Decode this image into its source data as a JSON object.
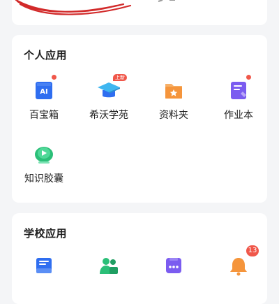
{
  "personal_apps": {
    "title": "个人应用",
    "items": [
      {
        "label": "百宝箱",
        "icon": "ai-icon",
        "icon_text": "AI",
        "dot": true
      },
      {
        "label": "希沃学苑",
        "icon": "graduation-cap-icon",
        "badge": "上新"
      },
      {
        "label": "资料夹",
        "icon": "folder-star-icon"
      },
      {
        "label": "作业本",
        "icon": "homework-book-icon",
        "dot": true
      },
      {
        "label": "知识胶囊",
        "icon": "knowledge-capsule-icon"
      }
    ]
  },
  "school_apps": {
    "title": "学校应用",
    "items": [
      {
        "icon": "inbox-icon"
      },
      {
        "icon": "user-group-icon"
      },
      {
        "icon": "more-apps-icon"
      },
      {
        "icon": "bell-icon",
        "badge": "13"
      }
    ]
  },
  "colors": {
    "accent_red": "#f0574a",
    "blue": "#3a7bf0",
    "green": "#2bbf78",
    "orange": "#f5953c",
    "purple": "#7b5cf0"
  }
}
